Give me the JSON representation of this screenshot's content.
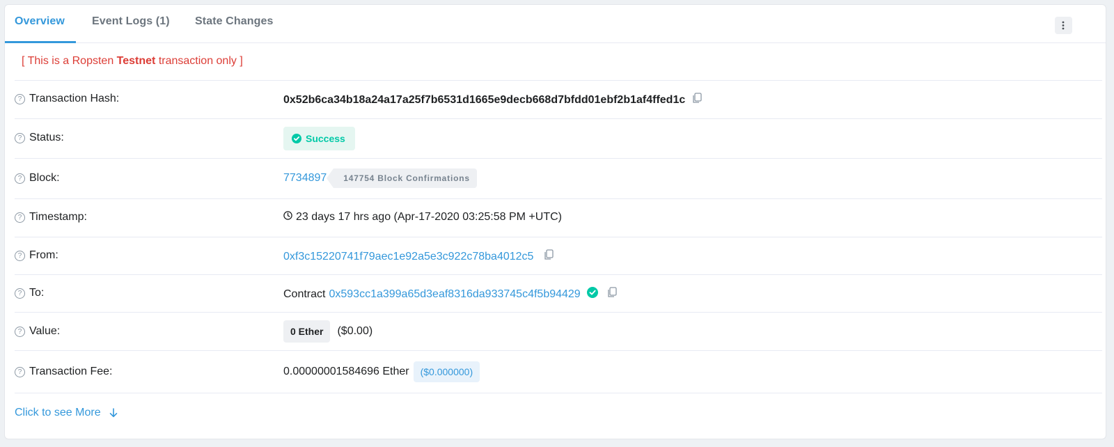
{
  "tabs": [
    {
      "label": "Overview",
      "active": true
    },
    {
      "label": "Event Logs (1)",
      "active": false
    },
    {
      "label": "State Changes",
      "active": false
    }
  ],
  "notice": {
    "prefix": "[ This is a Ropsten ",
    "bold": "Testnet",
    "suffix": " transaction only ]"
  },
  "rows": {
    "hash": {
      "label": "Transaction Hash:",
      "value": "0x52b6ca34b18a24a17a25f7b6531d1665e9decb668d7bfdd01ebf2b1af4ffed1c"
    },
    "status": {
      "label": "Status:",
      "value": "Success"
    },
    "block": {
      "label": "Block:",
      "value": "7734897",
      "confirmations": "147754 Block Confirmations"
    },
    "timestamp": {
      "label": "Timestamp:",
      "value": "23 days 17 hrs ago (Apr-17-2020 03:25:58 PM +UTC)"
    },
    "from": {
      "label": "From:",
      "value": "0xf3c15220741f79aec1e92a5e3c922c78ba4012c5"
    },
    "to": {
      "label": "To:",
      "prefix": "Contract",
      "value": "0x593cc1a399a65d3eaf8316da933745c4f5b94429"
    },
    "value": {
      "label": "Value:",
      "amount": "0 Ether",
      "usd": "($0.00)"
    },
    "fee": {
      "label": "Transaction Fee:",
      "value": "0.00000001584696 Ether",
      "usd": "($0.000000)"
    }
  },
  "more_label": "Click to see More",
  "colors": {
    "accent": "#3498db",
    "success": "#00c9a7",
    "notice": "#dc3d36"
  }
}
